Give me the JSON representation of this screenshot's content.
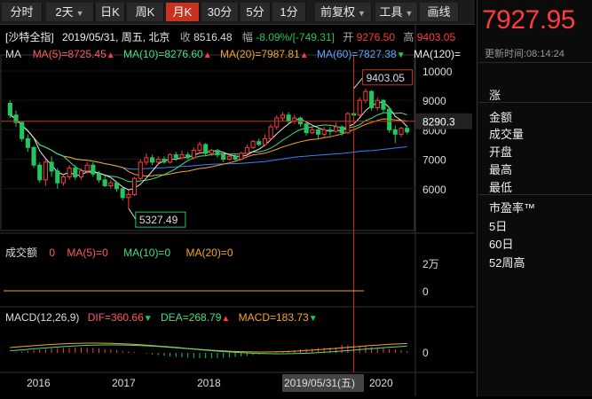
{
  "toolbar": {
    "items": [
      {
        "label": "分时",
        "dropdown": false,
        "active": false
      },
      {
        "label": "2天",
        "dropdown": true,
        "active": false
      },
      {
        "label": "日K",
        "dropdown": false,
        "active": false
      },
      {
        "label": "周K",
        "dropdown": false,
        "active": false
      },
      {
        "label": "月K",
        "dropdown": false,
        "active": true
      },
      {
        "label": "30分",
        "dropdown": false,
        "active": false
      },
      {
        "label": "5分",
        "dropdown": false,
        "active": false
      },
      {
        "label": "1分",
        "dropdown": false,
        "active": false
      },
      {
        "label": "前复权",
        "dropdown": true,
        "active": false
      },
      {
        "label": "工具",
        "dropdown": true,
        "active": false
      },
      {
        "label": "画线",
        "dropdown": false,
        "active": false
      }
    ]
  },
  "quote": {
    "name": "[沙特全指]",
    "date": "2019/05/31, 周五, 北京",
    "close_label": "收",
    "close": "8516.48",
    "change_label": "幅",
    "change": "-8.09%/[-749.31]",
    "open_label": "开",
    "open": "9276.50",
    "high_label": "高",
    "high": "9403.05"
  },
  "ma": {
    "label": "MA",
    "ma5": "MA(5)=8725.45",
    "ma10": "MA(10)=8276.60",
    "ma20": "MA(20)=7987.81",
    "ma60": "MA(60)=7827.38",
    "ma120": "MA(120)="
  },
  "volume": {
    "label": "成交额",
    "value": "0",
    "ma5": "MA(5)=0",
    "ma10": "MA(10)=0",
    "ma20": "MA(20)=0",
    "axis_top": "2万",
    "axis_zero": "0"
  },
  "macd": {
    "label": "MACD(12,26,9)",
    "dif": "DIF=360.66",
    "dea": "DEA=268.79",
    "macd": "MACD=183.73",
    "axis_zero": "0"
  },
  "right_panel": {
    "price": "7927.95",
    "updated": "更新时间:08:14:24",
    "labels": [
      "涨",
      "金额",
      "成交量",
      "开盘",
      "最高",
      "最低",
      "市盈率™",
      "5日",
      "60日",
      "52周高"
    ]
  },
  "chart_data": {
    "type": "candlestick",
    "price_axis_ticks": [
      "10000",
      "9000",
      "8000",
      "7000",
      "6000"
    ],
    "ylim": [
      5000,
      10300
    ],
    "current_price_tag": "8290.3",
    "max_label": "9403.05",
    "min_label": "5327.49",
    "x_labels": [
      "2016",
      "2017",
      "2018",
      "2019/05/31(五)",
      "2020"
    ],
    "candles": [
      {
        "o": 8900,
        "c": 8500,
        "h": 9000,
        "l": 8400
      },
      {
        "o": 8500,
        "c": 8250,
        "h": 8650,
        "l": 8100
      },
      {
        "o": 8250,
        "c": 7700,
        "h": 8300,
        "l": 7600
      },
      {
        "o": 7700,
        "c": 7400,
        "h": 7850,
        "l": 7250
      },
      {
        "o": 7400,
        "c": 6800,
        "h": 7450,
        "l": 6700
      },
      {
        "o": 6800,
        "c": 6300,
        "h": 6900,
        "l": 6200
      },
      {
        "o": 6300,
        "c": 6900,
        "h": 7000,
        "l": 6100
      },
      {
        "o": 6900,
        "c": 6600,
        "h": 7100,
        "l": 6400
      },
      {
        "o": 6600,
        "c": 6200,
        "h": 6700,
        "l": 6000
      },
      {
        "o": 6200,
        "c": 6400,
        "h": 6500,
        "l": 6100
      },
      {
        "o": 6400,
        "c": 6700,
        "h": 6800,
        "l": 6300
      },
      {
        "o": 6700,
        "c": 6400,
        "h": 6800,
        "l": 6300
      },
      {
        "o": 6400,
        "c": 6600,
        "h": 6700,
        "l": 6300
      },
      {
        "o": 6600,
        "c": 6800,
        "h": 6900,
        "l": 6500
      },
      {
        "o": 6800,
        "c": 6500,
        "h": 6900,
        "l": 6400
      },
      {
        "o": 6500,
        "c": 6300,
        "h": 6600,
        "l": 6200
      },
      {
        "o": 6300,
        "c": 6100,
        "h": 6450,
        "l": 6050
      },
      {
        "o": 6100,
        "c": 6200,
        "h": 6300,
        "l": 6000
      },
      {
        "o": 6200,
        "c": 6000,
        "h": 6250,
        "l": 5900
      },
      {
        "o": 6000,
        "c": 5700,
        "h": 6050,
        "l": 5600
      },
      {
        "o": 5700,
        "c": 5800,
        "h": 5950,
        "l": 5327
      },
      {
        "o": 5800,
        "c": 6350,
        "h": 6400,
        "l": 5750
      },
      {
        "o": 6350,
        "c": 6900,
        "h": 7000,
        "l": 6300
      },
      {
        "o": 6900,
        "c": 7050,
        "h": 7200,
        "l": 6800
      },
      {
        "o": 7050,
        "c": 6900,
        "h": 7150,
        "l": 6800
      },
      {
        "o": 6900,
        "c": 7000,
        "h": 7100,
        "l": 6800
      },
      {
        "o": 7000,
        "c": 6900,
        "h": 7100,
        "l": 6850
      },
      {
        "o": 6900,
        "c": 7150,
        "h": 7200,
        "l": 6850
      },
      {
        "o": 7150,
        "c": 7050,
        "h": 7250,
        "l": 6950
      },
      {
        "o": 7050,
        "c": 7150,
        "h": 7300,
        "l": 7000
      },
      {
        "o": 7150,
        "c": 7050,
        "h": 7250,
        "l": 7000
      },
      {
        "o": 7050,
        "c": 7300,
        "h": 7400,
        "l": 7000
      },
      {
        "o": 7300,
        "c": 7500,
        "h": 7600,
        "l": 7200
      },
      {
        "o": 7500,
        "c": 7200,
        "h": 7550,
        "l": 7100
      },
      {
        "o": 7200,
        "c": 7300,
        "h": 7350,
        "l": 7100
      },
      {
        "o": 7300,
        "c": 7150,
        "h": 7350,
        "l": 7050
      },
      {
        "o": 7150,
        "c": 7000,
        "h": 7200,
        "l": 6900
      },
      {
        "o": 7000,
        "c": 7100,
        "h": 7200,
        "l": 6950
      },
      {
        "o": 7100,
        "c": 7000,
        "h": 7200,
        "l": 6950
      },
      {
        "o": 7000,
        "c": 7200,
        "h": 7250,
        "l": 6950
      },
      {
        "o": 7200,
        "c": 7400,
        "h": 7500,
        "l": 7150
      },
      {
        "o": 7400,
        "c": 7600,
        "h": 7650,
        "l": 7350
      },
      {
        "o": 7600,
        "c": 7500,
        "h": 7700,
        "l": 7450
      },
      {
        "o": 7500,
        "c": 7700,
        "h": 7850,
        "l": 7450
      },
      {
        "o": 7700,
        "c": 8100,
        "h": 8200,
        "l": 7650
      },
      {
        "o": 8100,
        "c": 8400,
        "h": 8500,
        "l": 8000
      },
      {
        "o": 8400,
        "c": 8500,
        "h": 8600,
        "l": 8300
      },
      {
        "o": 8500,
        "c": 8300,
        "h": 8600,
        "l": 8200
      },
      {
        "o": 8300,
        "c": 8400,
        "h": 8500,
        "l": 8200
      },
      {
        "o": 8400,
        "c": 8200,
        "h": 8450,
        "l": 8100
      },
      {
        "o": 8200,
        "c": 7900,
        "h": 8250,
        "l": 7800
      },
      {
        "o": 7900,
        "c": 8000,
        "h": 8100,
        "l": 7850
      },
      {
        "o": 8000,
        "c": 7850,
        "h": 8050,
        "l": 7700
      },
      {
        "o": 7850,
        "c": 8000,
        "h": 8100,
        "l": 7750
      },
      {
        "o": 8000,
        "c": 7950,
        "h": 8100,
        "l": 7800
      },
      {
        "o": 7950,
        "c": 8100,
        "h": 8250,
        "l": 7900
      },
      {
        "o": 8100,
        "c": 7900,
        "h": 8150,
        "l": 7800
      },
      {
        "o": 7900,
        "c": 8550,
        "h": 8600,
        "l": 7850
      },
      {
        "o": 8550,
        "c": 8500,
        "h": 8700,
        "l": 8400
      },
      {
        "o": 8500,
        "c": 9000,
        "h": 9100,
        "l": 8450
      },
      {
        "o": 9000,
        "c": 9300,
        "h": 9403,
        "l": 8900
      },
      {
        "o": 9300,
        "c": 8750,
        "h": 9350,
        "l": 8650
      },
      {
        "o": 8750,
        "c": 9000,
        "h": 9100,
        "l": 8650
      },
      {
        "o": 9000,
        "c": 8700,
        "h": 9050,
        "l": 8600
      },
      {
        "o": 8700,
        "c": 8000,
        "h": 8750,
        "l": 7900
      },
      {
        "o": 8000,
        "c": 7850,
        "h": 8150,
        "l": 7550
      },
      {
        "o": 7850,
        "c": 8050,
        "h": 8100,
        "l": 7750
      },
      {
        "o": 8050,
        "c": 7930,
        "h": 8150,
        "l": 7850
      }
    ]
  },
  "colors": {
    "up": "#ff3b3b",
    "down": "#22c55e",
    "ma5": "#e8e8e8",
    "ma10": "#4ade80",
    "ma20": "#f5a623",
    "ma60": "#3b82f6",
    "ma120": "#ffffff"
  }
}
